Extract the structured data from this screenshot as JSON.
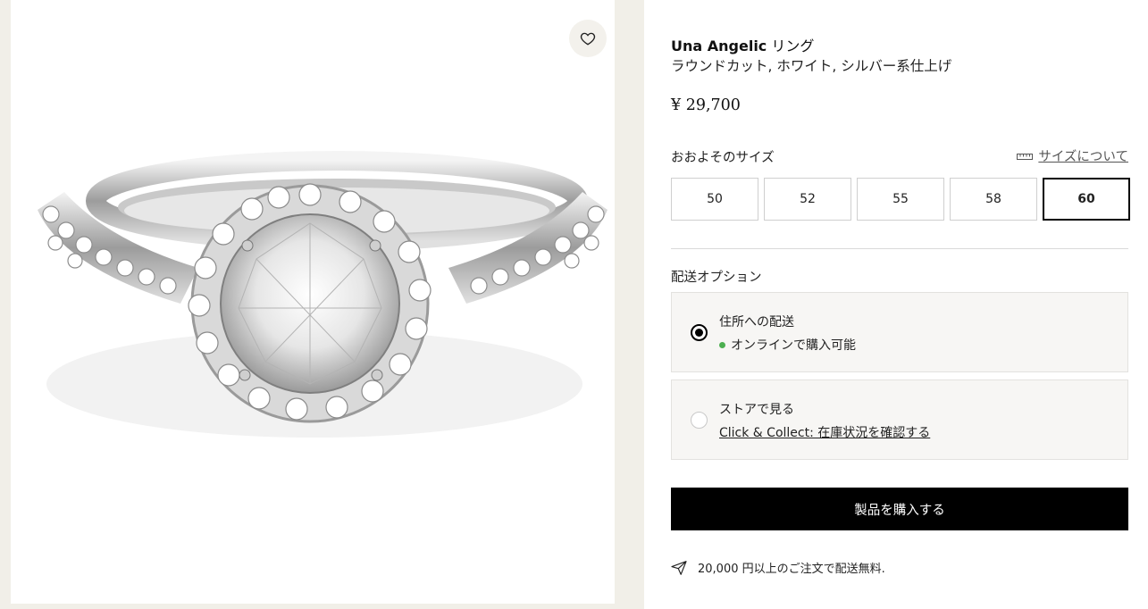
{
  "product": {
    "brand_name": "Una Angelic",
    "name_suffix": "リング",
    "subtitle": "ラウンドカット, ホワイト, シルバー系仕上げ",
    "price": "¥ 29,700"
  },
  "size": {
    "label": "おおよそのサイズ",
    "guide_link": "サイズについて",
    "options": [
      "50",
      "52",
      "55",
      "58",
      "60"
    ],
    "selected": "60"
  },
  "shipping": {
    "label": "配送オプション",
    "home": {
      "title": "住所への配送",
      "status": "オンラインで購入可能",
      "status_color": "#4caf50"
    },
    "store": {
      "title": "ストアで見る",
      "link": "Click & Collect: 在庫状況を確認する"
    }
  },
  "buy_button": "製品を購入する",
  "free_shipping_note": "20,000 円以上のご注文で配送無料.",
  "icons": {
    "wishlist": "heart-icon",
    "size_guide": "ruler-icon",
    "shipping": "paper-plane-icon"
  }
}
